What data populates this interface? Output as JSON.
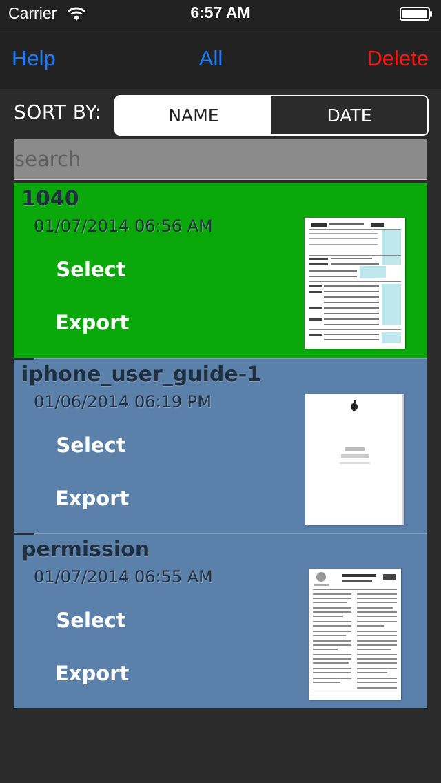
{
  "status_bar": {
    "carrier": "Carrier",
    "time": "6:57 AM",
    "wifi_icon": "wifi-icon",
    "battery_icon": "battery-icon"
  },
  "nav": {
    "help": "Help",
    "all": "All",
    "delete": "Delete",
    "accent_color": "#1b7dfc",
    "delete_color": "#f21a12"
  },
  "sort": {
    "label": "SORT BY:",
    "options": [
      "NAME",
      "DATE"
    ],
    "selected": "NAME"
  },
  "search": {
    "placeholder": "search",
    "value": ""
  },
  "documents": [
    {
      "name": "1040",
      "date": "01/07/2014 06:56 AM",
      "select_label": "Select",
      "export_label": "Export",
      "row_color": "#0aa80a",
      "thumbnail": "tax-form-thumbnail"
    },
    {
      "name": "iphone_user_guide-1",
      "date": "01/06/2014 06:19 PM",
      "select_label": "Select",
      "export_label": "Export",
      "row_color": "#5b80a9",
      "thumbnail": "user-guide-thumbnail"
    },
    {
      "name": "permission",
      "date": "01/07/2014 06:55 AM",
      "select_label": "Select",
      "export_label": "Export",
      "row_color": "#5b80a9",
      "thumbnail": "permission-form-thumbnail"
    }
  ]
}
